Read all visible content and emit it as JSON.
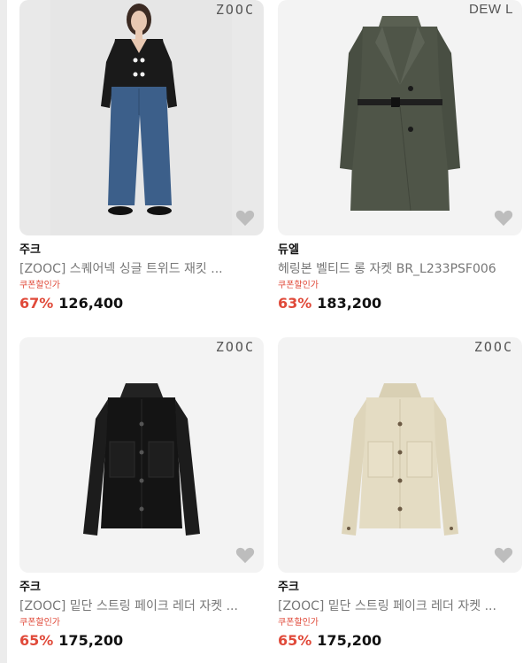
{
  "products": [
    {
      "logo": "ZOOC",
      "brand": "주크",
      "title": "[ZOOC] 스퀘어넥 싱글 트위드 재킷 ...",
      "coupon": "쿠폰할인가",
      "discount": "67%",
      "price": "126,400",
      "image": "model-black-tweed-jacket-jeans",
      "colors": {
        "jacket": "#1a1a1a",
        "jeans": "#3c5f8a",
        "background": "#e9e9e9"
      }
    },
    {
      "logo": "DEW L",
      "brand": "듀엘",
      "title": "헤링본 벨티드 롱 자켓 BR_L233PSF006",
      "coupon": "쿠폰할인가",
      "discount": "63%",
      "price": "183,200",
      "image": "herringbone-belted-long-jacket",
      "colors": {
        "jacket": "#4f5548",
        "background": "#f3f3f3"
      }
    },
    {
      "logo": "ZOOC",
      "brand": "주크",
      "title": "[ZOOC] 밑단 스트링 페이크 레더 자켓 ...",
      "coupon": "쿠폰할인가",
      "discount": "65%",
      "price": "175,200",
      "image": "black-faux-leather-jacket",
      "colors": {
        "jacket": "#141414",
        "background": "#f3f3f3"
      }
    },
    {
      "logo": "ZOOC",
      "brand": "주크",
      "title": "[ZOOC] 밑단 스트링 페이크 레더 자켓 ...",
      "coupon": "쿠폰할인가",
      "discount": "65%",
      "price": "175,200",
      "image": "cream-faux-leather-jacket",
      "colors": {
        "jacket": "#e4dcc3",
        "background": "#f3f3f3"
      }
    }
  ],
  "icons": {
    "wishlist": "heart-icon"
  },
  "accent_color": "#e04a3a"
}
